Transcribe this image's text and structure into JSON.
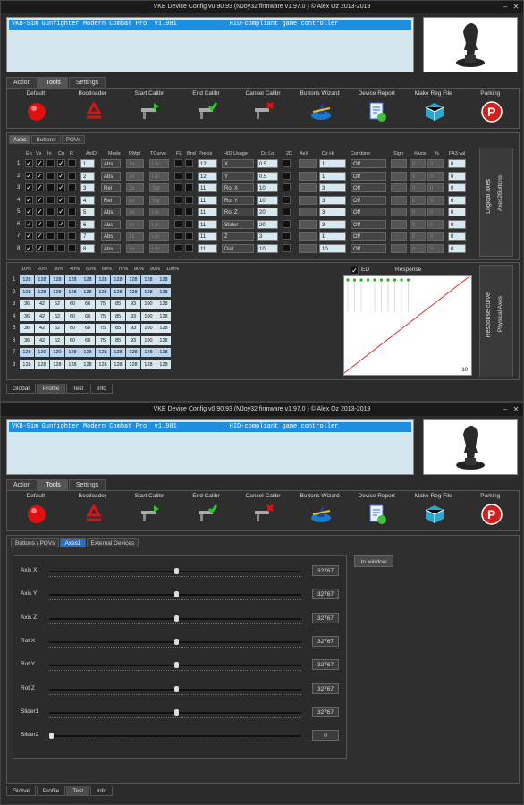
{
  "title": "VKB Device Config v0.90.93 (NJoy32 firmware v1.97.0  ) © Alex Oz 2013-2019",
  "device_row": "VKB-Sim Gunfighter Modern Combat Pro  v1.981            : HID-compliant game controller",
  "main_tabs": [
    "Action",
    "Tools",
    "Settings"
  ],
  "tools": [
    {
      "label": "Default",
      "icon": "red-ball-icon"
    },
    {
      "label": "Bootloader",
      "icon": "recycle-icon"
    },
    {
      "label": "Start Calibr",
      "icon": "caliper-play-icon"
    },
    {
      "label": "End Calibr",
      "icon": "caliper-check-icon"
    },
    {
      "label": "Cancel Calibr",
      "icon": "caliper-cancel-icon"
    },
    {
      "label": "Buttons Wizard",
      "icon": "wizard-hat-icon"
    },
    {
      "label": "Device Report",
      "icon": "report-icon"
    },
    {
      "label": "Make Reg File",
      "icon": "registry-cube-icon"
    },
    {
      "label": "Parking",
      "icon": "parking-icon"
    }
  ],
  "top": {
    "subtabs": [
      "Axes",
      "Buttons",
      "POVs"
    ],
    "headers": [
      "En",
      "Vs",
      "In",
      "Cn",
      "R",
      "AxID",
      "Mode",
      "RMpl",
      "TCurve",
      "FL",
      "Bnd",
      "Precis",
      "HID Usage",
      "Dz Lo",
      "2D",
      "AxX",
      "Dz Hi",
      "Combine",
      "Sign",
      "#Axis",
      "%",
      "FA3 val"
    ],
    "rows": [
      {
        "n": "1",
        "en": true,
        "vs": true,
        "inv": false,
        "cn": true,
        "axid": "1",
        "mode": "Abs",
        "rmpl": "1x",
        "tc": "Lin",
        "prec": "12",
        "hid": "X",
        "dzlo": "0.5",
        "axx": "",
        "dzhi": "1",
        "comb": "Off",
        "sign": "",
        "axis": "0",
        "pct": "0",
        "fa3": "0"
      },
      {
        "n": "2",
        "en": true,
        "vs": true,
        "inv": false,
        "cn": true,
        "axid": "2",
        "mode": "Abs",
        "rmpl": "1x",
        "tc": "Lin",
        "prec": "12",
        "hid": "Y",
        "dzlo": "0.5",
        "axx": "",
        "dzhi": "1",
        "comb": "Off",
        "sign": "",
        "axis": "0",
        "pct": "0",
        "fa3": "0"
      },
      {
        "n": "3",
        "en": true,
        "vs": true,
        "inv": false,
        "cn": true,
        "axid": "3",
        "mode": "Rel",
        "rmpl": "2x",
        "tc": "Sqr",
        "prec": "11",
        "hid": "Rot X",
        "dzlo": "10",
        "axx": "",
        "dzhi": "3",
        "comb": "Off",
        "sign": "",
        "axis": "0",
        "pct": "0",
        "fa3": "0"
      },
      {
        "n": "4",
        "en": true,
        "vs": true,
        "inv": false,
        "cn": true,
        "axid": "4",
        "mode": "Rel",
        "rmpl": "2x",
        "tc": "Sqr",
        "prec": "11",
        "hid": "Rot Y",
        "dzlo": "10",
        "axx": "",
        "dzhi": "3",
        "comb": "Off",
        "sign": "",
        "axis": "0",
        "pct": "0",
        "fa3": "0"
      },
      {
        "n": "5",
        "en": true,
        "vs": true,
        "inv": false,
        "cn": true,
        "axid": "5",
        "mode": "Abs",
        "rmpl": "1x",
        "tc": "Lin",
        "prec": "11",
        "hid": "Rot Z",
        "dzlo": "20",
        "axx": "",
        "dzhi": "3",
        "comb": "Off",
        "sign": "",
        "axis": "0",
        "pct": "0",
        "fa3": "0"
      },
      {
        "n": "6",
        "en": true,
        "vs": true,
        "inv": false,
        "cn": true,
        "axid": "6",
        "mode": "Abs",
        "rmpl": "1x",
        "tc": "Lin",
        "prec": "11",
        "hid": "Slider",
        "dzlo": "20",
        "axx": "",
        "dzhi": "3",
        "comb": "Off",
        "sign": "",
        "axis": "0",
        "pct": "0",
        "fa3": "0"
      },
      {
        "n": "7",
        "en": true,
        "vs": true,
        "inv": false,
        "cn": false,
        "axid": "7",
        "mode": "Abs",
        "rmpl": "1x",
        "tc": "Lin",
        "prec": "11",
        "hid": "Z",
        "dzlo": "3",
        "axx": "",
        "dzhi": "1",
        "comb": "Off",
        "sign": "",
        "axis": "0",
        "pct": "0",
        "fa3": "0"
      },
      {
        "n": "8",
        "en": true,
        "vs": true,
        "inv": false,
        "cn": false,
        "axid": "8",
        "mode": "Abs",
        "rmpl": "1x",
        "tc": "Lin",
        "prec": "11",
        "hid": "Dial",
        "dzlo": "10",
        "axx": "",
        "dzhi": "10",
        "comb": "Off",
        "sign": "",
        "axis": "0",
        "pct": "0",
        "fa3": "0"
      }
    ],
    "side_label_1": "Logical axes",
    "side_label_2": "Axes2Buttons",
    "curve_headers": [
      "10%",
      "20%",
      "30%",
      "40%",
      "50%",
      "60%",
      "70%",
      "80%",
      "90%",
      "100%"
    ],
    "curve_rows": [
      [
        "128",
        "128",
        "128",
        "128",
        "128",
        "128",
        "128",
        "128",
        "128",
        "128"
      ],
      [
        "128",
        "128",
        "128",
        "128",
        "128",
        "128",
        "128",
        "128",
        "128",
        "128"
      ],
      [
        "36",
        "42",
        "52",
        "60",
        "68",
        "75",
        "85",
        "93",
        "100",
        "128"
      ],
      [
        "36",
        "42",
        "52",
        "60",
        "68",
        "75",
        "85",
        "93",
        "100",
        "128"
      ],
      [
        "36",
        "42",
        "52",
        "60",
        "68",
        "75",
        "85",
        "93",
        "100",
        "128"
      ],
      [
        "36",
        "42",
        "52",
        "60",
        "68",
        "75",
        "85",
        "93",
        "100",
        "128"
      ],
      [
        "128",
        "120",
        "120",
        "128",
        "128",
        "128",
        "128",
        "128",
        "128",
        "128"
      ],
      [
        "128",
        "128",
        "128",
        "128",
        "128",
        "128",
        "128",
        "128",
        "128",
        "128"
      ]
    ],
    "ed_label": "ED",
    "response_label": "Response",
    "response_value": "10",
    "side_label_3": "Response curve",
    "side_label_4": "Physical Axes",
    "bottom_tabs": [
      "Global",
      "Profile",
      "Test",
      "Info"
    ]
  },
  "bottom": {
    "subtabs": [
      "Buttons / POVs",
      "Axes1",
      "External Devices"
    ],
    "in_window": "In window",
    "axes": [
      {
        "name": "Axis X",
        "value": "32767",
        "pos": 0.5
      },
      {
        "name": "Axis Y",
        "value": "32767",
        "pos": 0.5
      },
      {
        "name": "Axis Z",
        "value": "32767",
        "pos": 0.5
      },
      {
        "name": "Rot X",
        "value": "32767",
        "pos": 0.5
      },
      {
        "name": "Rot Y",
        "value": "32767",
        "pos": 0.5
      },
      {
        "name": "Rot Z",
        "value": "32767",
        "pos": 0.5
      },
      {
        "name": "Slider1",
        "value": "32767",
        "pos": 0.5
      },
      {
        "name": "Slider2",
        "value": "0",
        "pos": 0.0
      }
    ],
    "bottom_tabs": [
      "Global",
      "Profile",
      "Test",
      "Info"
    ]
  },
  "colors": {
    "accent": "#1e8ee0",
    "field": "#d8e8f0",
    "curve": "#e03020"
  }
}
